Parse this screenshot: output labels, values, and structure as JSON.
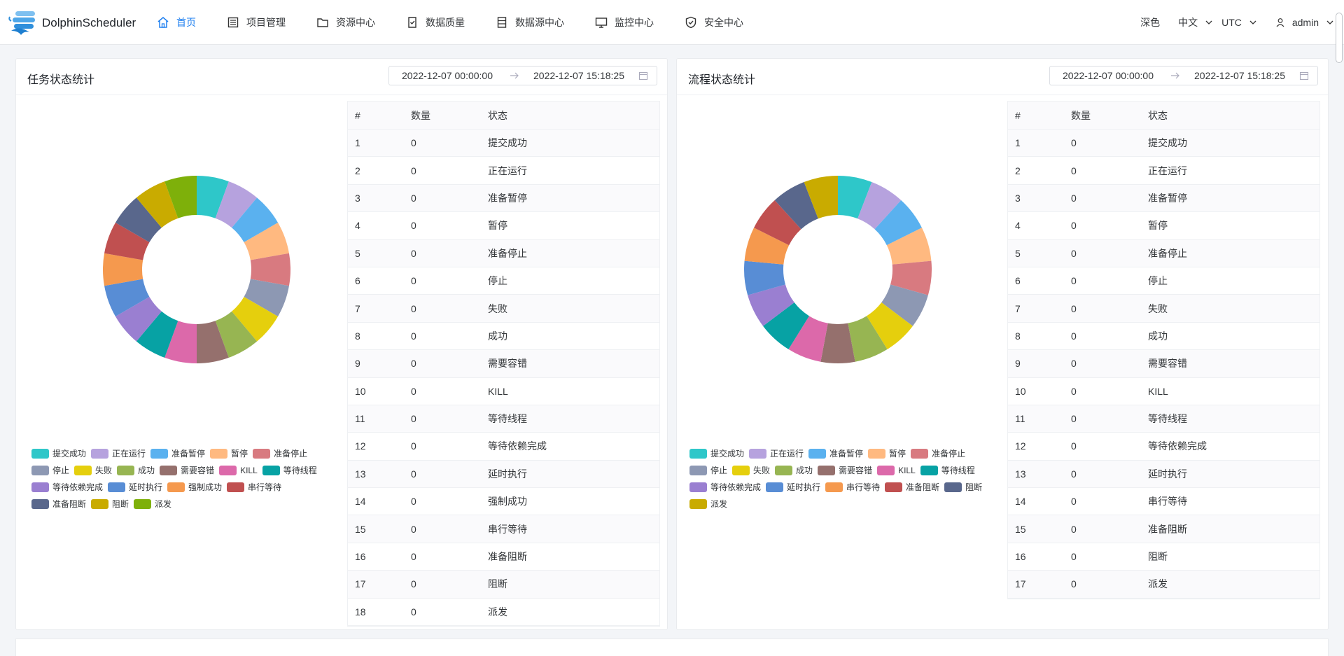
{
  "app": {
    "name": "DolphinScheduler"
  },
  "nav": [
    {
      "label": "首页",
      "icon": "home-icon",
      "active": true
    },
    {
      "label": "项目管理",
      "icon": "project-icon"
    },
    {
      "label": "资源中心",
      "icon": "folder-icon"
    },
    {
      "label": "数据质量",
      "icon": "quality-icon"
    },
    {
      "label": "数据源中心",
      "icon": "datasource-icon"
    },
    {
      "label": "监控中心",
      "icon": "monitor-icon"
    },
    {
      "label": "安全中心",
      "icon": "shield-icon"
    }
  ],
  "header_right": {
    "theme": "深色",
    "language": "中文",
    "timezone": "UTC",
    "user": "admin"
  },
  "colors": {
    "accent": "#2080f0",
    "palette": [
      "#2ec7c9",
      "#b6a2de",
      "#5ab1ef",
      "#ffb980",
      "#d87a80",
      "#8d98b3",
      "#e5cf0d",
      "#97b552",
      "#95706d",
      "#dc69aa",
      "#07a2a4",
      "#9a7fd1",
      "#588dd5",
      "#f5994e",
      "#c05050",
      "#59678c",
      "#c9ab00",
      "#7eb00a"
    ]
  },
  "task_state": {
    "title": "任务状态统计",
    "range_start": "2022-12-07 00:00:00",
    "range_end": "2022-12-07 15:18:25",
    "columns": [
      "#",
      "数量",
      "状态"
    ],
    "rows": [
      [
        "1",
        "0",
        "提交成功"
      ],
      [
        "2",
        "0",
        "正在运行"
      ],
      [
        "3",
        "0",
        "准备暂停"
      ],
      [
        "4",
        "0",
        "暂停"
      ],
      [
        "5",
        "0",
        "准备停止"
      ],
      [
        "6",
        "0",
        "停止"
      ],
      [
        "7",
        "0",
        "失败"
      ],
      [
        "8",
        "0",
        "成功"
      ],
      [
        "9",
        "0",
        "需要容错"
      ],
      [
        "10",
        "0",
        "KILL"
      ],
      [
        "11",
        "0",
        "等待线程"
      ],
      [
        "12",
        "0",
        "等待依赖完成"
      ],
      [
        "13",
        "0",
        "延时执行"
      ],
      [
        "14",
        "0",
        "强制成功"
      ],
      [
        "15",
        "0",
        "串行等待"
      ],
      [
        "16",
        "0",
        "准备阻断"
      ],
      [
        "17",
        "0",
        "阻断"
      ],
      [
        "18",
        "0",
        "派发"
      ]
    ],
    "legend": [
      "提交成功",
      "正在运行",
      "准备暂停",
      "暂停",
      "准备停止",
      "停止",
      "失败",
      "成功",
      "需要容错",
      "KILL",
      "等待线程",
      "等待依赖完成",
      "延时执行",
      "强制成功",
      "串行等待",
      "准备阻断",
      "阻断",
      "派发"
    ]
  },
  "process_state": {
    "title": "流程状态统计",
    "range_start": "2022-12-07 00:00:00",
    "range_end": "2022-12-07 15:18:25",
    "columns": [
      "#",
      "数量",
      "状态"
    ],
    "rows": [
      [
        "1",
        "0",
        "提交成功"
      ],
      [
        "2",
        "0",
        "正在运行"
      ],
      [
        "3",
        "0",
        "准备暂停"
      ],
      [
        "4",
        "0",
        "暂停"
      ],
      [
        "5",
        "0",
        "准备停止"
      ],
      [
        "6",
        "0",
        "停止"
      ],
      [
        "7",
        "0",
        "失败"
      ],
      [
        "8",
        "0",
        "成功"
      ],
      [
        "9",
        "0",
        "需要容错"
      ],
      [
        "10",
        "0",
        "KILL"
      ],
      [
        "11",
        "0",
        "等待线程"
      ],
      [
        "12",
        "0",
        "等待依赖完成"
      ],
      [
        "13",
        "0",
        "延时执行"
      ],
      [
        "14",
        "0",
        "串行等待"
      ],
      [
        "15",
        "0",
        "准备阻断"
      ],
      [
        "16",
        "0",
        "阻断"
      ],
      [
        "17",
        "0",
        "派发"
      ]
    ],
    "legend": [
      "提交成功",
      "正在运行",
      "准备暂停",
      "暂停",
      "准备停止",
      "停止",
      "失败",
      "成功",
      "需要容错",
      "KILL",
      "等待线程",
      "等待依赖完成",
      "延时执行",
      "串行等待",
      "准备阻断",
      "阻断",
      "派发"
    ]
  },
  "chart_data": [
    {
      "type": "pie",
      "variant": "donut",
      "title": "任务状态统计",
      "categories": [
        "提交成功",
        "正在运行",
        "准备暂停",
        "暂停",
        "准备停止",
        "停止",
        "失败",
        "成功",
        "需要容错",
        "KILL",
        "等待线程",
        "等待依赖完成",
        "延时执行",
        "强制成功",
        "串行等待",
        "准备阻断",
        "阻断",
        "派发"
      ],
      "values": [
        0,
        0,
        0,
        0,
        0,
        0,
        0,
        0,
        0,
        0,
        0,
        0,
        0,
        0,
        0,
        0,
        0,
        0
      ],
      "legend_position": "bottom"
    },
    {
      "type": "pie",
      "variant": "donut",
      "title": "流程状态统计",
      "categories": [
        "提交成功",
        "正在运行",
        "准备暂停",
        "暂停",
        "准备停止",
        "停止",
        "失败",
        "成功",
        "需要容错",
        "KILL",
        "等待线程",
        "等待依赖完成",
        "延时执行",
        "串行等待",
        "准备阻断",
        "阻断",
        "派发"
      ],
      "values": [
        0,
        0,
        0,
        0,
        0,
        0,
        0,
        0,
        0,
        0,
        0,
        0,
        0,
        0,
        0,
        0,
        0
      ],
      "legend_position": "bottom"
    }
  ]
}
